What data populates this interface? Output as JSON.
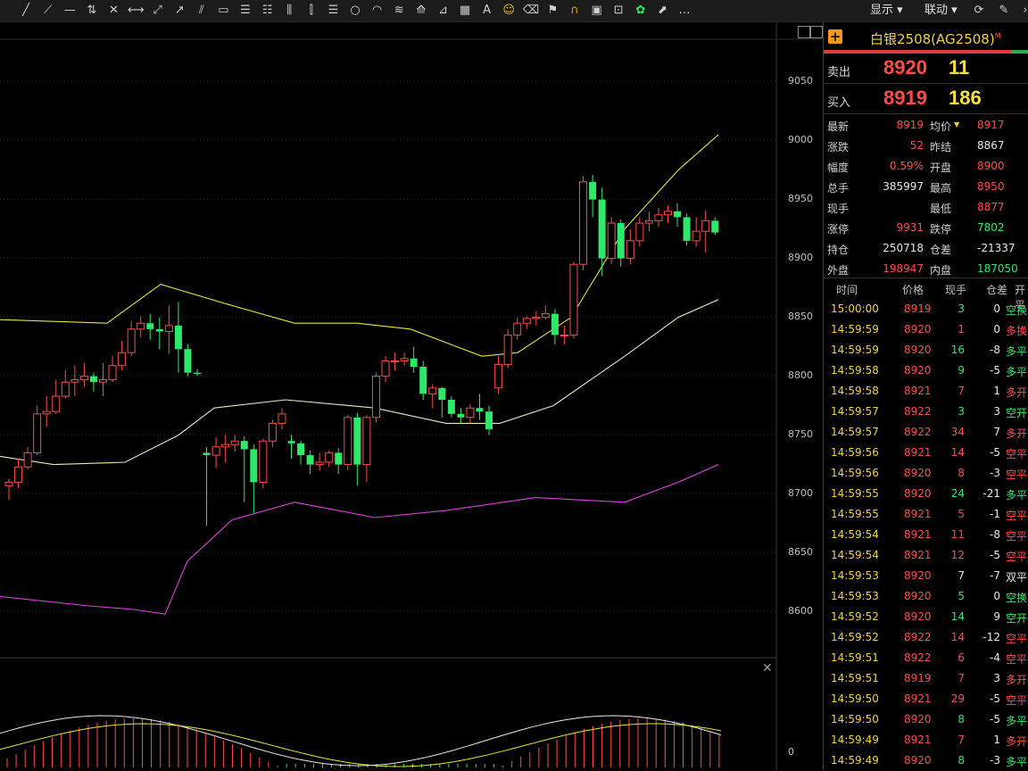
{
  "toolbar": {
    "tools": [
      "line-tool",
      "ray-tool",
      "segment-tool",
      "vertical-line-tool",
      "cross-line-tool",
      "arrow-line-tool",
      "extended-line-tool",
      "arrow-tool",
      "channel-tool",
      "rectangle-tool",
      "price-range-tool",
      "fib-retracement-tool",
      "parallel-channel-tool",
      "gann-tool",
      "bar-count-tool",
      "circle-tool",
      "arc-tool",
      "wave-tool",
      "fan-tool",
      "gann-fan-tool",
      "ruler-tool",
      "text-tool",
      "emoji-tool",
      "eraser-tool",
      "alert-tool",
      "magnet-tool",
      "note-tool",
      "hide-tool",
      "tree-tool",
      "export-tool",
      "more-tool"
    ],
    "more_label": "...",
    "display_label": "显示",
    "link_label": "联动"
  },
  "chart": {
    "y_axis_labels": [
      "9050",
      "9000",
      "8950",
      "8900",
      "8850",
      "8800",
      "8750",
      "8700",
      "8650",
      "8600"
    ],
    "sub_axis_label": "0",
    "colors": {
      "up": "#ff4a4a",
      "down": "#2ee86a",
      "upper_band": "#e6e63a",
      "middle_band": "#e8e8c0",
      "lower_band": "#e040e0"
    }
  },
  "chart_data": {
    "type": "candlestick",
    "ylim": [
      8575,
      9075
    ],
    "candles": [
      [
        8702,
        8705,
        8690,
        8708
      ],
      [
        8705,
        8718,
        8700,
        8725
      ],
      [
        8718,
        8730,
        8716,
        8735
      ],
      [
        8730,
        8763,
        8728,
        8770
      ],
      [
        8763,
        8765,
        8752,
        8778
      ],
      [
        8765,
        8778,
        8763,
        8792
      ],
      [
        8778,
        8790,
        8776,
        8800
      ],
      [
        8790,
        8792,
        8778,
        8804
      ],
      [
        8792,
        8795,
        8786,
        8806
      ],
      [
        8795,
        8790,
        8782,
        8798
      ],
      [
        8790,
        8792,
        8778,
        8806
      ],
      [
        8792,
        8804,
        8790,
        8812
      ],
      [
        8804,
        8815,
        8800,
        8825
      ],
      [
        8815,
        8835,
        8812,
        8842
      ],
      [
        8835,
        8840,
        8828,
        8846
      ],
      [
        8840,
        8835,
        8826,
        8848
      ],
      [
        8835,
        8833,
        8818,
        8845
      ],
      [
        8833,
        8838,
        8814,
        8855
      ],
      [
        8838,
        8818,
        8798,
        8858
      ],
      [
        8818,
        8798,
        8795,
        8822
      ],
      [
        8798,
        8797,
        8795,
        8801
      ],
      [
        8730,
        8728,
        8668,
        8735
      ],
      [
        8728,
        8735,
        8717,
        8743
      ],
      [
        8735,
        8737,
        8722,
        8745
      ],
      [
        8737,
        8740,
        8731,
        8745
      ],
      [
        8740,
        8733,
        8688,
        8744
      ],
      [
        8733,
        8705,
        8678,
        8737
      ],
      [
        8705,
        8740,
        8700,
        8742
      ],
      [
        8740,
        8755,
        8735,
        8758
      ],
      [
        8755,
        8763,
        8750,
        8768
      ],
      [
        8740,
        8738,
        8725,
        8745
      ],
      [
        8738,
        8728,
        8720,
        8740
      ],
      [
        8728,
        8720,
        8712,
        8732
      ],
      [
        8720,
        8722,
        8715,
        8730
      ],
      [
        8722,
        8730,
        8718,
        8732
      ],
      [
        8730,
        8720,
        8712,
        8734
      ],
      [
        8720,
        8760,
        8715,
        8762
      ],
      [
        8760,
        8720,
        8702,
        8764
      ],
      [
        8720,
        8760,
        8705,
        8762
      ],
      [
        8760,
        8795,
        8756,
        8798
      ],
      [
        8795,
        8808,
        8790,
        8812
      ],
      [
        8808,
        8808,
        8800,
        8815
      ],
      [
        8808,
        8810,
        8804,
        8815
      ],
      [
        8810,
        8803,
        8798,
        8820
      ],
      [
        8803,
        8780,
        8775,
        8808
      ],
      [
        8780,
        8785,
        8768,
        8788
      ],
      [
        8785,
        8775,
        8760,
        8786
      ],
      [
        8775,
        8763,
        8760,
        8778
      ],
      [
        8763,
        8760,
        8755,
        8768
      ],
      [
        8760,
        8768,
        8755,
        8771
      ],
      [
        8768,
        8765,
        8758,
        8780
      ],
      [
        8765,
        8750,
        8745,
        8770
      ],
      [
        8785,
        8805,
        8780,
        8812
      ],
      [
        8805,
        8830,
        8802,
        8835
      ],
      [
        8830,
        8840,
        8826,
        8845
      ],
      [
        8840,
        8844,
        8835,
        8846
      ],
      [
        8844,
        8845,
        8838,
        8850
      ],
      [
        8845,
        8848,
        8843,
        8855
      ],
      [
        8848,
        8830,
        8822,
        8852
      ],
      [
        8830,
        8830,
        8822,
        8838
      ],
      [
        8830,
        8890,
        8827,
        8892
      ],
      [
        8890,
        8960,
        8885,
        8965
      ],
      [
        8960,
        8945,
        8930,
        8966
      ],
      [
        8945,
        8895,
        8880,
        8955
      ],
      [
        8895,
        8925,
        8890,
        8930
      ],
      [
        8925,
        8895,
        8888,
        8928
      ],
      [
        8895,
        8910,
        8890,
        8920
      ],
      [
        8910,
        8925,
        8905,
        8930
      ],
      [
        8925,
        8927,
        8918,
        8935
      ],
      [
        8927,
        8932,
        8922,
        8938
      ],
      [
        8932,
        8935,
        8925,
        8940
      ],
      [
        8935,
        8930,
        8922,
        8942
      ],
      [
        8930,
        8910,
        8906,
        8933
      ],
      [
        8910,
        8918,
        8905,
        8930
      ],
      [
        8918,
        8927,
        8900,
        8936
      ],
      [
        8927,
        8917,
        8915,
        8930
      ]
    ],
    "upper_band": [
      [
        0,
        8843
      ],
      [
        120,
        8840
      ],
      [
        180,
        8873
      ],
      [
        260,
        8855
      ],
      [
        330,
        8840
      ],
      [
        400,
        8840
      ],
      [
        460,
        8835
      ],
      [
        540,
        8812
      ],
      [
        580,
        8815
      ],
      [
        640,
        8845
      ],
      [
        700,
        8920
      ],
      [
        760,
        8970
      ],
      [
        805,
        9000
      ]
    ],
    "middle_band": [
      [
        0,
        8727
      ],
      [
        60,
        8720
      ],
      [
        140,
        8722
      ],
      [
        200,
        8745
      ],
      [
        240,
        8768
      ],
      [
        320,
        8775
      ],
      [
        420,
        8768
      ],
      [
        500,
        8755
      ],
      [
        560,
        8755
      ],
      [
        620,
        8770
      ],
      [
        700,
        8812
      ],
      [
        760,
        8845
      ],
      [
        805,
        8860
      ]
    ],
    "lower_band": [
      [
        0,
        8608
      ],
      [
        100,
        8600
      ],
      [
        150,
        8597
      ],
      [
        185,
        8593
      ],
      [
        210,
        8638
      ],
      [
        260,
        8673
      ],
      [
        330,
        8688
      ],
      [
        420,
        8675
      ],
      [
        500,
        8681
      ],
      [
        600,
        8692
      ],
      [
        700,
        8688
      ],
      [
        760,
        8705
      ],
      [
        805,
        8720
      ]
    ]
  },
  "quote": {
    "symbol": "白银2508(AG2508)",
    "superscript": "M",
    "ask_label": "卖出",
    "ask_price": "8920",
    "ask_volume": "11",
    "bid_label": "买入",
    "bid_price": "8919",
    "bid_volume": "186",
    "rows": [
      {
        "l1": "最新",
        "v1": "8919",
        "c1": "red",
        "l2": "均价",
        "v2": "8917",
        "c2": "red",
        "dd": true
      },
      {
        "l1": "涨跌",
        "v1": "52",
        "c1": "red",
        "l2": "昨结",
        "v2": "8867",
        "c2": "white"
      },
      {
        "l1": "幅度",
        "v1": "0.59%",
        "c1": "red",
        "l2": "开盘",
        "v2": "8900",
        "c2": "red"
      },
      {
        "l1": "总手",
        "v1": "385997",
        "c1": "white",
        "l2": "最高",
        "v2": "8950",
        "c2": "red"
      },
      {
        "l1": "现手",
        "v1": "",
        "c1": "white",
        "l2": "最低",
        "v2": "8877",
        "c2": "red"
      },
      {
        "l1": "涨停",
        "v1": "9931",
        "c1": "red",
        "l2": "跌停",
        "v2": "7802",
        "c2": "green"
      },
      {
        "l1": "持仓",
        "v1": "250718",
        "c1": "white",
        "l2": "仓差",
        "v2": "-21337",
        "c2": "white"
      },
      {
        "l1": "外盘",
        "v1": "198947",
        "c1": "red",
        "l2": "内盘",
        "v2": "187050",
        "c2": "green"
      }
    ]
  },
  "ticks": {
    "headers": [
      "时间",
      "价格",
      "现手",
      "仓差",
      "开平"
    ],
    "rows": [
      [
        "15:00:00",
        "8919",
        "3",
        "0",
        "空换",
        "green"
      ],
      [
        "14:59:59",
        "8920",
        "1",
        "0",
        "多换",
        "red"
      ],
      [
        "14:59:59",
        "8920",
        "16",
        "-8",
        "多平",
        "green"
      ],
      [
        "14:59:58",
        "8920",
        "9",
        "-5",
        "多平",
        "green"
      ],
      [
        "14:59:58",
        "8921",
        "7",
        "1",
        "多开",
        "red"
      ],
      [
        "14:59:57",
        "8922",
        "3",
        "3",
        "空开",
        "green"
      ],
      [
        "14:59:57",
        "8922",
        "34",
        "7",
        "多开",
        "red"
      ],
      [
        "14:59:56",
        "8921",
        "14",
        "-5",
        "空平",
        "red"
      ],
      [
        "14:59:56",
        "8920",
        "8",
        "-3",
        "空平",
        "red"
      ],
      [
        "14:59:55",
        "8920",
        "24",
        "-21",
        "多平",
        "green"
      ],
      [
        "14:59:55",
        "8921",
        "5",
        "-1",
        "空平",
        "red"
      ],
      [
        "14:59:54",
        "8921",
        "11",
        "-8",
        "空平",
        "red"
      ],
      [
        "14:59:54",
        "8921",
        "12",
        "-5",
        "空平",
        "red"
      ],
      [
        "14:59:53",
        "8920",
        "7",
        "-7",
        "双平",
        "white"
      ],
      [
        "14:59:53",
        "8920",
        "5",
        "0",
        "空换",
        "green"
      ],
      [
        "14:59:52",
        "8920",
        "14",
        "9",
        "空开",
        "green"
      ],
      [
        "14:59:52",
        "8922",
        "14",
        "-12",
        "空平",
        "red"
      ],
      [
        "14:59:51",
        "8922",
        "6",
        "-4",
        "空平",
        "red"
      ],
      [
        "14:59:51",
        "8919",
        "7",
        "3",
        "多开",
        "red"
      ],
      [
        "14:59:50",
        "8921",
        "29",
        "-5",
        "空平",
        "red"
      ],
      [
        "14:59:50",
        "8920",
        "8",
        "-5",
        "多平",
        "green"
      ],
      [
        "14:59:49",
        "8921",
        "7",
        "1",
        "多开",
        "red"
      ],
      [
        "14:59:49",
        "8920",
        "8",
        "-3",
        "多平",
        "green"
      ]
    ]
  }
}
